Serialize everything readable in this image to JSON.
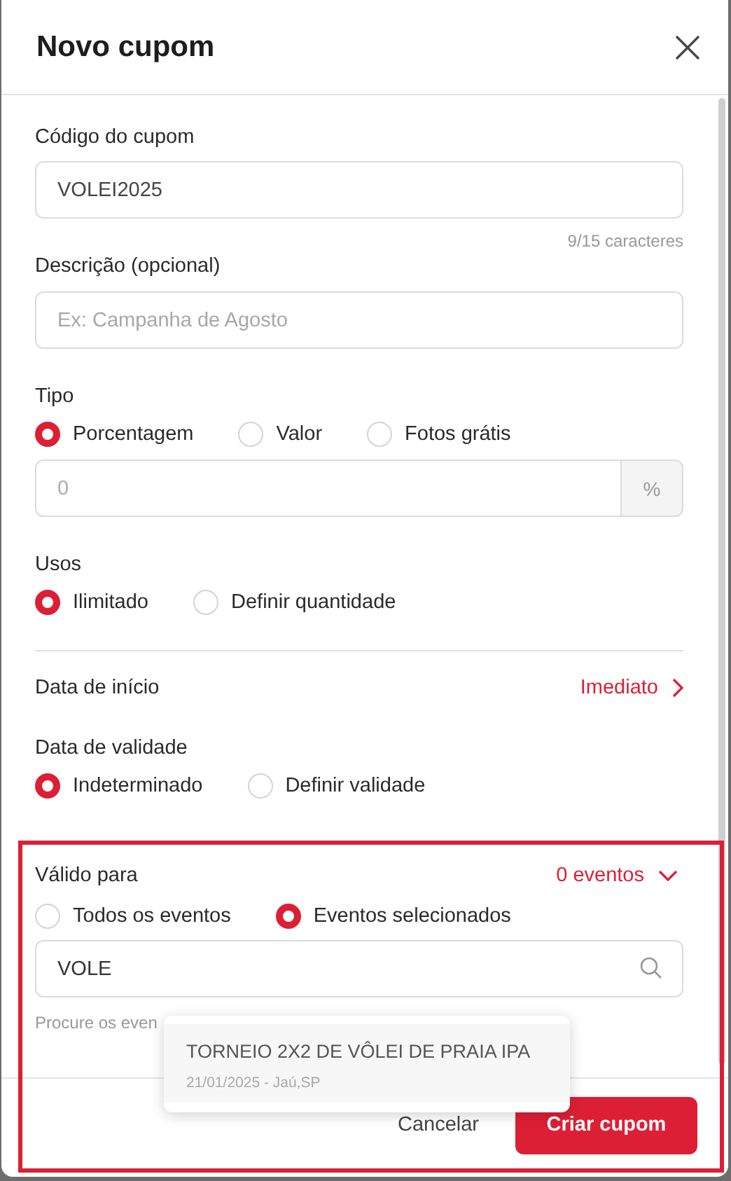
{
  "dialog": {
    "title": "Novo cupom"
  },
  "code": {
    "label": "Código do cupom",
    "value": "VOLEI2025",
    "counter": "9/15 caracteres"
  },
  "description": {
    "label": "Descrição (opcional)",
    "placeholder": "Ex: Campanha de Agosto"
  },
  "type": {
    "label": "Tipo",
    "options": [
      {
        "label": "Porcentagem",
        "selected": true
      },
      {
        "label": "Valor",
        "selected": false
      },
      {
        "label": "Fotos grátis",
        "selected": false
      }
    ],
    "amount": {
      "placeholder": "0",
      "suffix": "%"
    }
  },
  "uses": {
    "label": "Usos",
    "options": [
      {
        "label": "Ilimitado",
        "selected": true
      },
      {
        "label": "Definir quantidade",
        "selected": false
      }
    ]
  },
  "start_date": {
    "label": "Data de início",
    "value": "Imediato"
  },
  "validity": {
    "label": "Data de validade",
    "options": [
      {
        "label": "Indeterminado",
        "selected": true
      },
      {
        "label": "Definir validade",
        "selected": false
      }
    ]
  },
  "valid_for": {
    "label": "Válido para",
    "count": "0 eventos",
    "options": [
      {
        "label": "Todos os eventos",
        "selected": false
      },
      {
        "label": "Eventos selecionados",
        "selected": true
      }
    ],
    "search": {
      "value": "VOLE"
    },
    "hint": "Procure os even",
    "results": [
      {
        "title": "TORNEIO 2X2 DE VÔLEI DE PRAIA IPA",
        "subtitle": "21/01/2025 - Jaú,SP"
      }
    ]
  },
  "footer": {
    "buttons": [
      {
        "label": "Cancelar",
        "kind": "secondary"
      },
      {
        "label": "Criar cupom",
        "kind": "primary"
      }
    ]
  }
}
